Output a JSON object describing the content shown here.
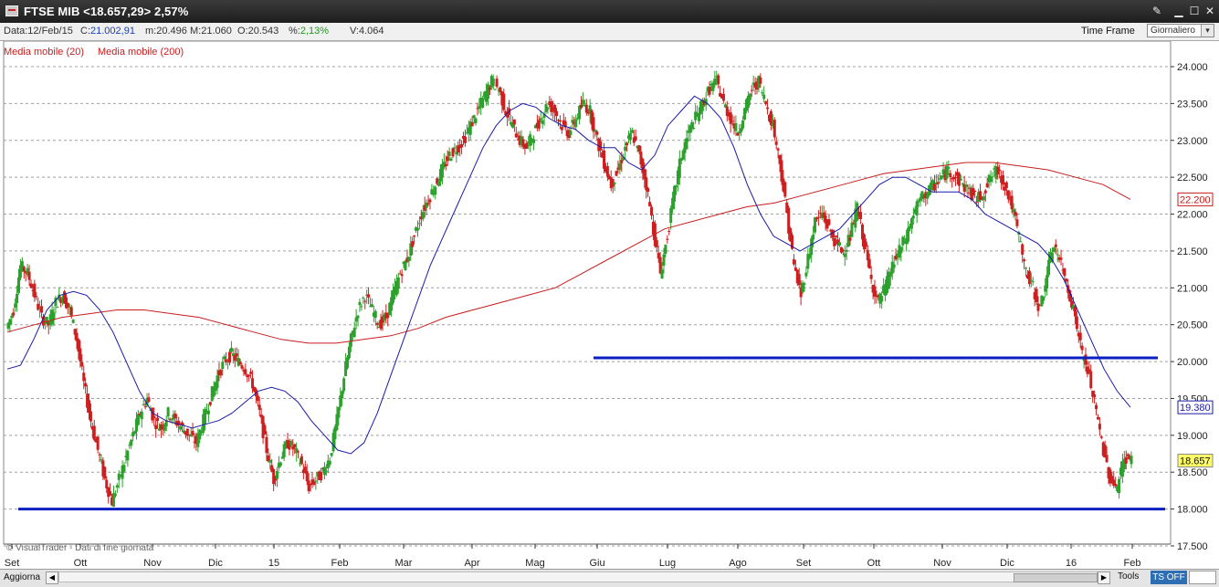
{
  "window": {
    "title": "FTSE MIB <18.657,29> 2,57%",
    "icons": [
      "chart-window-icon",
      "tools-icon",
      "minimize-icon",
      "maximize-icon",
      "close-icon"
    ]
  },
  "infobar": {
    "data_label": "Data:",
    "data_value": "12/Feb/15",
    "c_label": "C:",
    "c_value": "21.002,91",
    "a_label": "m:",
    "a_value": "20.496",
    "m_label": "M:",
    "m_value": "21.060",
    "o_label": "O:",
    "o_value": "20.543",
    "pct_label": "%:",
    "pct_value": "2,13%",
    "v_label": "V:",
    "v_value": "4.064",
    "time_frame_label": "Time Frame",
    "time_frame_value": "Giornaliero"
  },
  "legend": {
    "ma20": "Media mobile (20)",
    "ma200": "Media mobile (200)"
  },
  "watermark": "© VisualTrader - Dati di fine giornata",
  "bottombar": {
    "refresh_label": "Aggiorna",
    "tools_label": "Tools",
    "ts_label": "TS OFF"
  },
  "colors": {
    "up": "#2ca02c",
    "down": "#cc1f1f",
    "ma20": "#1a1aa8",
    "ma200": "#c81c1c",
    "support": "#0a1fbf",
    "grid": "#a0a0a0"
  },
  "chart_data": {
    "type": "candlestick",
    "y_ticks": [
      "24.000",
      "23.500",
      "23.000",
      "22.500",
      "22.000",
      "21.500",
      "21.000",
      "20.500",
      "20.000",
      "19.500",
      "19.000",
      "18.500",
      "18.000",
      "17.500"
    ],
    "y_range": [
      17500,
      24000
    ],
    "x_labels": [
      "Set",
      "Ott",
      "Nov",
      "Dic",
      "15",
      "Feb",
      "Mar",
      "Apr",
      "Mag",
      "Giu",
      "Lug",
      "Ago",
      "Set",
      "Ott",
      "Nov",
      "Dic",
      "16",
      "Feb"
    ],
    "price_tags": [
      {
        "value": "22.200",
        "series": "ma200"
      },
      {
        "value": "19.380",
        "series": "ma20"
      },
      {
        "value": "18.657",
        "series": "last"
      }
    ],
    "support_lines": [
      {
        "level": 18000,
        "from": "Set 2014",
        "to": "Feb 2016"
      },
      {
        "level": 20050,
        "from": "Giu 2015",
        "to": "Feb 2016"
      }
    ],
    "close_path": [
      20450,
      20700,
      21300,
      21200,
      20900,
      20600,
      20500,
      20800,
      20900,
      20700,
      20300,
      19700,
      19200,
      18800,
      18400,
      18100,
      18400,
      18700,
      19000,
      19300,
      19500,
      19200,
      19100,
      19300,
      19200,
      19100,
      19000,
      18900,
      19200,
      19500,
      19800,
      20000,
      20100,
      20000,
      19900,
      19700,
      19300,
      18800,
      18400,
      18700,
      18900,
      18800,
      18600,
      18300,
      18400,
      18500,
      18700,
      19200,
      19800,
      20300,
      20700,
      20900,
      20700,
      20500,
      20600,
      20900,
      21200,
      21400,
      21700,
      22000,
      22200,
      22400,
      22600,
      22800,
      22900,
      23000,
      23200,
      23400,
      23600,
      23800,
      23700,
      23400,
      23200,
      23000,
      22900,
      23100,
      23300,
      23500,
      23400,
      23200,
      23100,
      23300,
      23500,
      23400,
      23000,
      22700,
      22400,
      22600,
      22900,
      23100,
      22800,
      22400,
      21800,
      21200,
      21700,
      22300,
      22800,
      23100,
      23300,
      23500,
      23700,
      23800,
      23500,
      23300,
      23100,
      23400,
      23700,
      23800,
      23500,
      23200,
      22700,
      22000,
      21300,
      20900,
      21400,
      21900,
      22000,
      21800,
      21600,
      21500,
      21700,
      22100,
      21600,
      21100,
      20800,
      21000,
      21300,
      21500,
      21700,
      22000,
      22200,
      22300,
      22400,
      22500,
      22600,
      22500,
      22400,
      22300,
      22200,
      22300,
      22500,
      22600,
      22400,
      22100,
      21700,
      21200,
      21000,
      20700,
      21200,
      21600,
      21300,
      21000,
      20600,
      20100,
      19800,
      19300,
      18800,
      18400,
      18300,
      18700,
      18657
    ],
    "ma20_path": [
      19900,
      19950,
      20300,
      20700,
      20900,
      20950,
      20900,
      20700,
      20400,
      20000,
      19600,
      19300,
      19200,
      19150,
      19100,
      19150,
      19200,
      19300,
      19450,
      19600,
      19650,
      19600,
      19450,
      19200,
      19000,
      18800,
      18750,
      18900,
      19300,
      19800,
      20300,
      20800,
      21300,
      21700,
      22100,
      22500,
      22900,
      23200,
      23400,
      23500,
      23450,
      23300,
      23200,
      23150,
      23000,
      22900,
      22900,
      22700,
      22600,
      22800,
      23200,
      23400,
      23600,
      23500,
      23300,
      22900,
      22400,
      22000,
      21700,
      21600,
      21500,
      21600,
      21700,
      21800,
      22000,
      22200,
      22400,
      22500,
      22500,
      22400,
      22300,
      22300,
      22300,
      22200,
      22000,
      21900,
      21800,
      21700,
      21600,
      21400,
      21100,
      20700,
      20300,
      19900,
      19600,
      19380
    ],
    "ma200_path": [
      20400,
      20500,
      20600,
      20650,
      20700,
      20700,
      20650,
      20600,
      20500,
      20400,
      20300,
      20250,
      20250,
      20300,
      20350,
      20450,
      20600,
      20700,
      20800,
      20900,
      21000,
      21200,
      21400,
      21600,
      21800,
      21900,
      22000,
      22100,
      22150,
      22250,
      22350,
      22450,
      22550,
      22600,
      22650,
      22700,
      22700,
      22650,
      22600,
      22500,
      22400,
      22200
    ]
  }
}
